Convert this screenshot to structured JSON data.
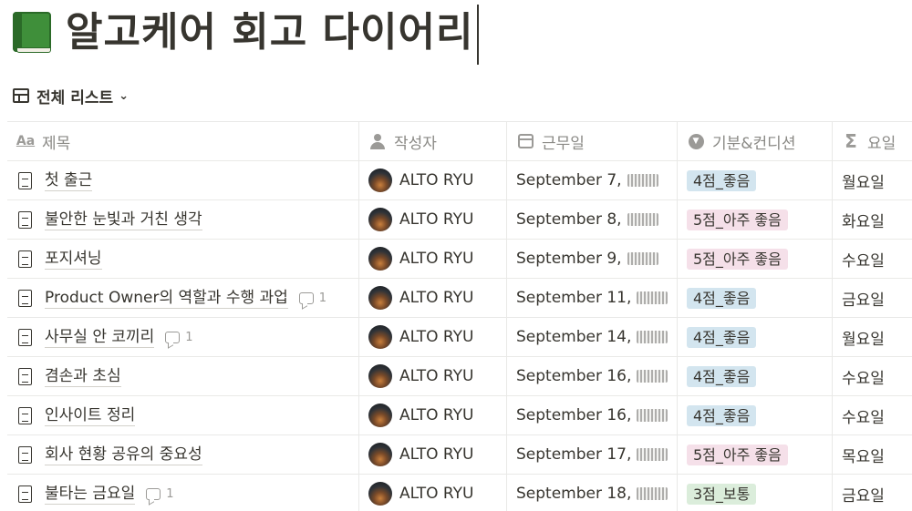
{
  "page": {
    "icon": "green-book-icon",
    "title": "알고케어 회고 다이어리"
  },
  "view": {
    "icon": "table-icon",
    "label": "전체 리스트"
  },
  "columns": [
    {
      "label": "제목",
      "icon": "aa-text-icon"
    },
    {
      "label": "작성자",
      "icon": "person-icon"
    },
    {
      "label": "근무일",
      "icon": "calendar-icon"
    },
    {
      "label": "기분&컨디션",
      "icon": "select-icon"
    },
    {
      "label": "요일",
      "icon": "sigma-icon"
    }
  ],
  "tag_colors": {
    "blue": "#d3e5ef",
    "pink": "#f5e0e9",
    "green": "#dbeddb"
  },
  "rows": [
    {
      "title": "첫 출근",
      "comments": "",
      "author": "ALTO RYU",
      "date": "September 7,",
      "mood": "4점_좋음",
      "mood_color": "blue",
      "day": "월요일"
    },
    {
      "title": "불안한 눈빛과 거친 생각",
      "comments": "",
      "author": "ALTO RYU",
      "date": "September 8,",
      "mood": "5점_아주 좋음",
      "mood_color": "pink",
      "day": "화요일"
    },
    {
      "title": "포지셔닝",
      "comments": "",
      "author": "ALTO RYU",
      "date": "September 9,",
      "mood": "5점_아주 좋음",
      "mood_color": "pink",
      "day": "수요일"
    },
    {
      "title": "Product Owner의 역할과 수행 과업",
      "comments": "1",
      "author": "ALTO RYU",
      "date": "September 11,",
      "mood": "4점_좋음",
      "mood_color": "blue",
      "day": "금요일"
    },
    {
      "title": "사무실 안 코끼리",
      "comments": "1",
      "author": "ALTO RYU",
      "date": "September 14,",
      "mood": "4점_좋음",
      "mood_color": "blue",
      "day": "월요일"
    },
    {
      "title": "겸손과 초심",
      "comments": "",
      "author": "ALTO RYU",
      "date": "September 16,",
      "mood": "4점_좋음",
      "mood_color": "blue",
      "day": "수요일"
    },
    {
      "title": "인사이트 정리",
      "comments": "",
      "author": "ALTO RYU",
      "date": "September 16,",
      "mood": "4점_좋음",
      "mood_color": "blue",
      "day": "수요일"
    },
    {
      "title": "회사 현황 공유의 중요성",
      "comments": "",
      "author": "ALTO RYU",
      "date": "September 17,",
      "mood": "5점_아주 좋음",
      "mood_color": "pink",
      "day": "목요일"
    },
    {
      "title": "불타는 금요일",
      "comments": "1",
      "author": "ALTO RYU",
      "date": "September 18,",
      "mood": "3점_보통",
      "mood_color": "green",
      "day": "금요일"
    }
  ]
}
